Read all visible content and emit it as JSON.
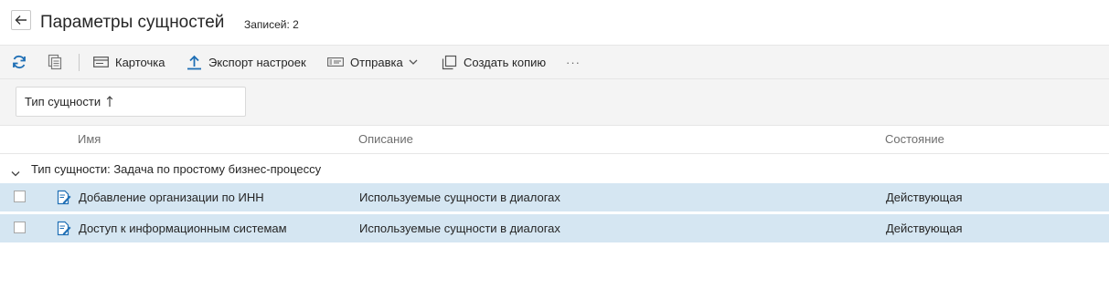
{
  "header": {
    "title": "Параметры сущностей",
    "record_count": "Записей: 2"
  },
  "toolbar": {
    "items": [
      {
        "icon": "refresh-icon",
        "label": ""
      },
      {
        "icon": "copy-list-icon",
        "label": ""
      },
      {
        "icon": "card-icon",
        "label": "Карточка"
      },
      {
        "icon": "upload-icon",
        "label": "Экспорт настроек"
      },
      {
        "icon": "send-icon",
        "label": "Отправка"
      },
      {
        "icon": "duplicate-icon",
        "label": "Создать копию"
      },
      {
        "icon": "more-icon",
        "label": "···"
      }
    ]
  },
  "filter": {
    "sort_label": "Тип сущности"
  },
  "columns": {
    "name": "Имя",
    "description": "Описание",
    "state": "Состояние"
  },
  "group": {
    "label": "Тип сущности: Задача по простому бизнес-процессу"
  },
  "rows": [
    {
      "name": "Добавление организации по ИНН",
      "description": "Используемые сущности в диалогах",
      "state": "Действующая"
    },
    {
      "name": "Доступ к информационным системам",
      "description": "Используемые сущности в диалогах",
      "state": "Действующая"
    }
  ],
  "colors": {
    "accent": "#1f6fb5",
    "row_selected": "#d5e6f2",
    "toolbar_bg": "#f4f4f4"
  }
}
